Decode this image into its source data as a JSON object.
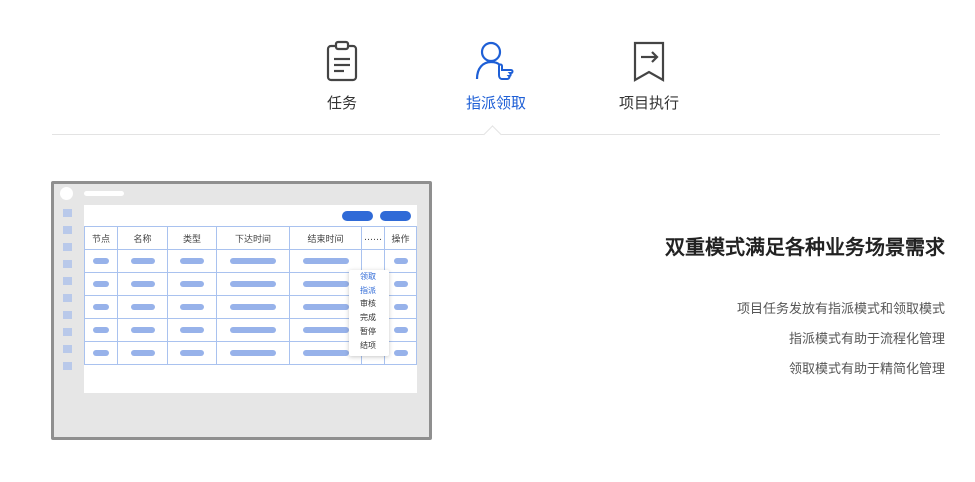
{
  "tabs": [
    {
      "label": "任务",
      "icon": "clipboard-icon",
      "active": false
    },
    {
      "label": "指派领取",
      "icon": "user-pointing-icon",
      "active": true
    },
    {
      "label": "项目执行",
      "icon": "bookmark-arrow-icon",
      "active": false
    }
  ],
  "colors": {
    "accent": "#1e5fd6",
    "bar": "#97b2ea",
    "frame": "#8f8f8f"
  },
  "table": {
    "headers": [
      "节点",
      "名称",
      "类型",
      "下达时间",
      "结束时间",
      "……",
      "操作"
    ],
    "row_count": 5
  },
  "menu": {
    "items": [
      "领取",
      "指派",
      "审核",
      "完成",
      "暂停",
      "结项"
    ]
  },
  "feature": {
    "title": "双重模式满足各种业务场景需求",
    "lines": [
      "项目任务发放有指派模式和领取模式",
      "指派模式有助于流程化管理",
      "领取模式有助于精简化管理"
    ]
  }
}
